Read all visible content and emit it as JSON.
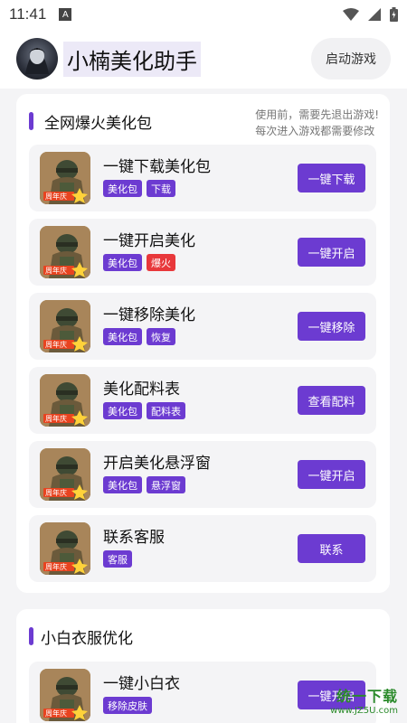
{
  "status": {
    "time": "11:41",
    "a_icon": "A"
  },
  "header": {
    "title": "小楠美化助手",
    "launch_label": "启动游戏"
  },
  "section1": {
    "title": "全网爆火美化包",
    "note_line1": "使用前，需要先退出游戏!",
    "note_line2": "每次进入游戏都需要修改",
    "items": [
      {
        "title": "一键下载美化包",
        "tags": [
          {
            "text": "美化包",
            "color": "purple"
          },
          {
            "text": "下载",
            "color": "purple"
          }
        ],
        "action": "一键下载"
      },
      {
        "title": "一键开启美化",
        "tags": [
          {
            "text": "美化包",
            "color": "purple"
          },
          {
            "text": "爆火",
            "color": "red"
          }
        ],
        "action": "一键开启"
      },
      {
        "title": "一键移除美化",
        "tags": [
          {
            "text": "美化包",
            "color": "purple"
          },
          {
            "text": "恢复",
            "color": "purple"
          }
        ],
        "action": "一键移除"
      },
      {
        "title": "美化配料表",
        "tags": [
          {
            "text": "美化包",
            "color": "purple"
          },
          {
            "text": "配料表",
            "color": "purple"
          }
        ],
        "action": "查看配料"
      },
      {
        "title": "开启美化悬浮窗",
        "tags": [
          {
            "text": "美化包",
            "color": "purple"
          },
          {
            "text": "悬浮窗",
            "color": "purple"
          }
        ],
        "action": "一键开启"
      },
      {
        "title": "联系客服",
        "tags": [
          {
            "text": "客服",
            "color": "purple"
          }
        ],
        "action": "联系"
      }
    ]
  },
  "section2": {
    "title": "小白衣服优化",
    "items": [
      {
        "title": "一键小白衣",
        "tags": [
          {
            "text": "移除皮肤",
            "color": "purple"
          }
        ],
        "action": "一键开启"
      }
    ]
  },
  "thumb_label": "周年庆",
  "watermark": {
    "main": "统一下载",
    "url": "www.JZ5U.com"
  },
  "colors": {
    "accent": "#6c3bd1",
    "tag_red": "#e8383b",
    "background": "#f4f4f6"
  },
  "icons": [
    "wifi-icon",
    "signal-icon",
    "battery-icon",
    "avatar",
    "game-thumbnail"
  ]
}
